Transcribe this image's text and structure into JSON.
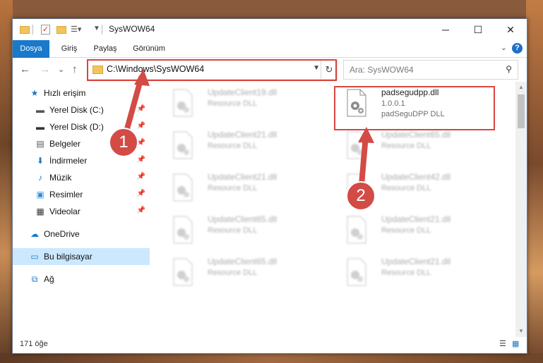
{
  "window": {
    "title": "SysWOW64",
    "min": "─",
    "max": "☐",
    "close": "✕"
  },
  "ribbon": {
    "tabs": [
      "Dosya",
      "Giriş",
      "Paylaş",
      "Görünüm"
    ],
    "help": "?",
    "collapse": "⌄"
  },
  "nav": {
    "back": "←",
    "forward": "→",
    "recent": "⌄",
    "up": "↑",
    "address": "C:\\Windows\\SysWOW64",
    "search_placeholder": "Ara: SysWOW64"
  },
  "sidebar": {
    "items": [
      {
        "label": "Hızlı erişim"
      },
      {
        "label": "Yerel Disk (C:)"
      },
      {
        "label": "Yerel Disk (D:)"
      },
      {
        "label": "Belgeler"
      },
      {
        "label": "İndirmeler"
      },
      {
        "label": "Müzik"
      },
      {
        "label": "Resimler"
      },
      {
        "label": "Videolar"
      },
      {
        "label": "OneDrive"
      },
      {
        "label": "Bu bilgisayar"
      },
      {
        "label": "Ağ"
      }
    ]
  },
  "files": {
    "left": [
      {
        "name": "UpdateClient19.dll",
        "type": "Resource DLL"
      },
      {
        "name": "UpdateClient21.dll",
        "type": "Resource DLL"
      },
      {
        "name": "UpdateClient21.dll",
        "type": "Resource DLL"
      },
      {
        "name": "UpdateClient65.dll",
        "type": "Resource DLL"
      },
      {
        "name": "UpdateClient65.dll",
        "type": "Resource DLL"
      }
    ],
    "right": [
      {
        "name": "UpdateClient65.dll",
        "type": "Resource DLL"
      },
      {
        "name": "UpdateClient42.dll",
        "type": "Resource DLL"
      },
      {
        "name": "UpdateClient21.dll",
        "type": "Resource DLL"
      },
      {
        "name": "UpdateClient21.dll",
        "type": "Resource DLL"
      }
    ],
    "target": {
      "name": "padsegudpp.dll",
      "version": "1.0.0.1",
      "description": "padSeguDPP DLL"
    }
  },
  "status": {
    "count": "171 öğe"
  },
  "annotations": {
    "step1": "1",
    "step2": "2"
  },
  "colors": {
    "accent": "#1979ca",
    "highlight": "#d9463f",
    "selected": "#cce8ff"
  }
}
